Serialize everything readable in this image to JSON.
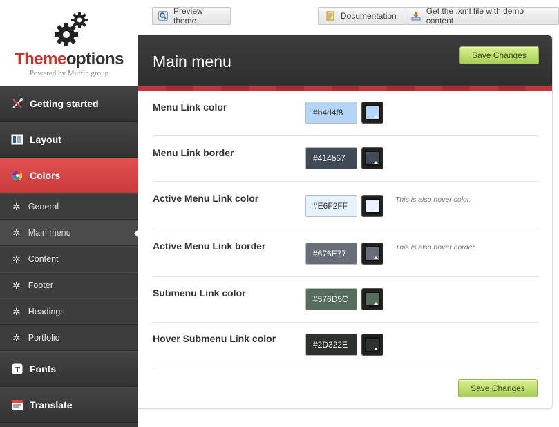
{
  "logo": {
    "title_part1": "Theme",
    "title_part2": "options",
    "subtitle": "Powered by Muffin group"
  },
  "topbar": {
    "preview_label": "Preview theme",
    "docs_label": "Documentation",
    "xml_label": "Get the .xml file with demo content"
  },
  "sidebar": {
    "items": [
      {
        "label": "Getting started",
        "icon": "tools-icon"
      },
      {
        "label": "Layout",
        "icon": "layout-icon"
      },
      {
        "label": "Colors",
        "icon": "color-wheel-icon"
      },
      {
        "label": "General",
        "icon": "gear-icon"
      },
      {
        "label": "Main menu",
        "icon": "gear-icon"
      },
      {
        "label": "Content",
        "icon": "gear-icon"
      },
      {
        "label": "Footer",
        "icon": "gear-icon"
      },
      {
        "label": "Headings",
        "icon": "gear-icon"
      },
      {
        "label": "Portfolio",
        "icon": "gear-icon"
      },
      {
        "label": "Fonts",
        "icon": "font-icon"
      },
      {
        "label": "Translate",
        "icon": "translate-icon"
      }
    ]
  },
  "panel": {
    "title": "Main menu",
    "save_label": "Save Changes",
    "rows": [
      {
        "label": "Menu Link color",
        "value": "#b4d4f8",
        "hint": ""
      },
      {
        "label": "Menu Link border",
        "value": "#414b57",
        "hint": ""
      },
      {
        "label": "Active Menu Link color",
        "value": "#E6F2FF",
        "hint": "This is also hover color."
      },
      {
        "label": "Active Menu Link border",
        "value": "#676E77",
        "hint": "This is also hover border."
      },
      {
        "label": "Submenu Link color",
        "value": "#576D5C",
        "hint": ""
      },
      {
        "label": "Hover Submenu Link color",
        "value": "#2D322E",
        "hint": ""
      }
    ]
  },
  "colors": {
    "accent_red": "#c9302c",
    "save_green": "#a8cf55"
  }
}
